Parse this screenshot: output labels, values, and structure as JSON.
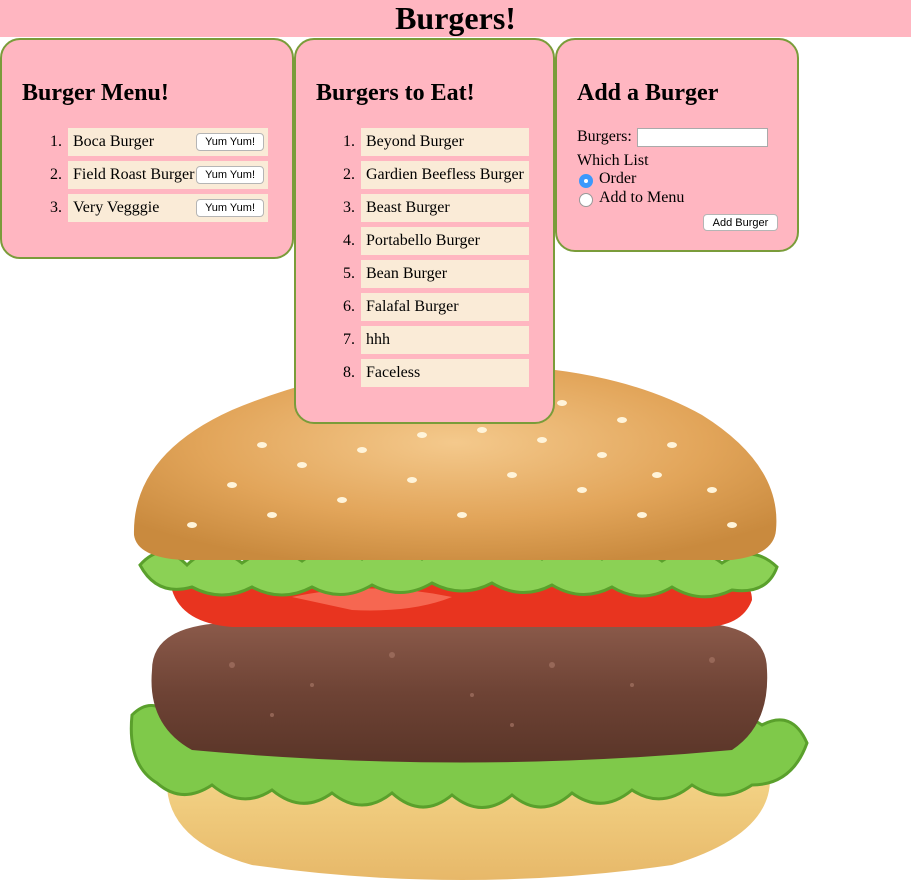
{
  "header": {
    "title": "Burgers!"
  },
  "menu_panel": {
    "title": "Burger Menu!",
    "items": [
      {
        "num": "1.",
        "label": "Boca Burger",
        "button": "Yum Yum!"
      },
      {
        "num": "2.",
        "label": "Field Roast Burger",
        "button": "Yum Yum!"
      },
      {
        "num": "3.",
        "label": "Very Vegggie",
        "button": "Yum Yum!"
      }
    ]
  },
  "eat_panel": {
    "title": "Burgers to Eat!",
    "items": [
      {
        "num": "1.",
        "label": "Beyond Burger"
      },
      {
        "num": "2.",
        "label": "Gardien Beefless Burger"
      },
      {
        "num": "3.",
        "label": "Beast Burger"
      },
      {
        "num": "4.",
        "label": "Portabello Burger"
      },
      {
        "num": "5.",
        "label": "Bean Burger"
      },
      {
        "num": "6.",
        "label": "Falafal Burger"
      },
      {
        "num": "7.",
        "label": "hhh"
      },
      {
        "num": "8.",
        "label": "Faceless"
      }
    ]
  },
  "add_panel": {
    "title": "Add a Burger",
    "burgers_label": "Burgers:",
    "burgers_value": "",
    "which_list_label": "Which List",
    "option_order": "Order",
    "option_menu": "Add to Menu",
    "selected_option": "Order",
    "submit_label": "Add Burger"
  },
  "colors": {
    "panel_bg": "#ffb6c1",
    "panel_border": "#7a9c3a",
    "item_bg": "#faebd7",
    "radio_selected": "#3b99fc"
  },
  "icons": [
    "burger-image"
  ]
}
